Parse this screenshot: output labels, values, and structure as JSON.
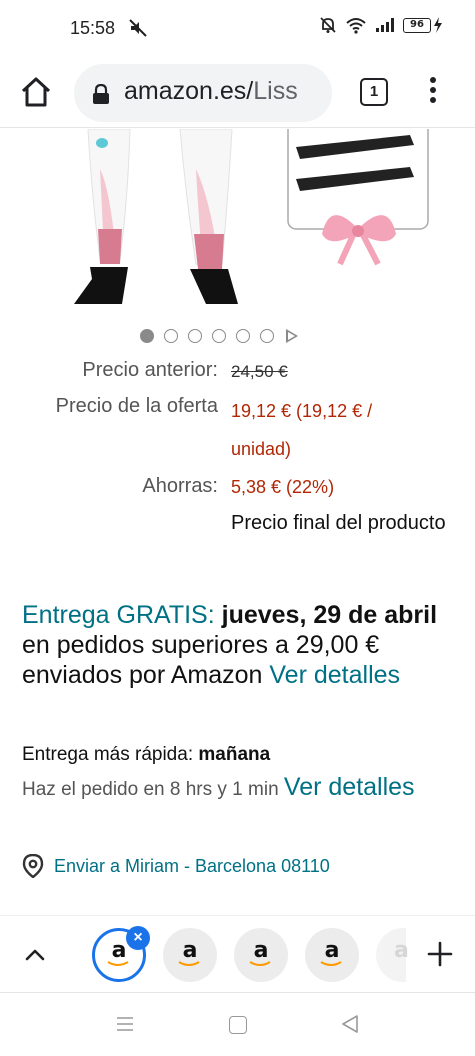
{
  "status_bar": {
    "time": "15:58",
    "battery": "96",
    "icons": [
      "mute-icon",
      "bell-off-icon",
      "wifi-icon",
      "signal-icon",
      "battery-icon",
      "charging-icon"
    ]
  },
  "browser": {
    "url_main": "amazon.es/",
    "url_fade": "Liss",
    "tab_count": "1",
    "icons": [
      "home-icon",
      "lock-icon",
      "menu-icon"
    ]
  },
  "carousel": {
    "total_dots": 6,
    "active_index": 0
  },
  "prices": {
    "previous_label": "Precio anterior:",
    "previous_value": "24,50 €",
    "offer_label": "Precio de la oferta",
    "offer_value_1": "19,12 € (19,12 € /",
    "offer_value_2": "unidad)",
    "savings_label": "Ahorras:",
    "savings_value": "5,38 € (22%)",
    "final_note": "Precio final del producto"
  },
  "delivery": {
    "free_label": "Entrega GRATIS:",
    "date": "jueves, 29 de abril",
    "rest": " en pedidos superiores a 29,00 € enviados por Amazon ",
    "details_link": "Ver detalles"
  },
  "fast_delivery": {
    "label": "Entrega más rápida: ",
    "when": "mañana",
    "order_within": "Haz el pedido en 8 hrs y 1 min ",
    "details_link": "Ver detalles"
  },
  "ship_to": {
    "text": "Enviar a Miriam - Barcelona 08110"
  },
  "tab_strip": {
    "tab_letter": "a"
  },
  "colors": {
    "link": "#007185",
    "price_red": "#b12704",
    "tab_accent": "#1a73e8"
  }
}
